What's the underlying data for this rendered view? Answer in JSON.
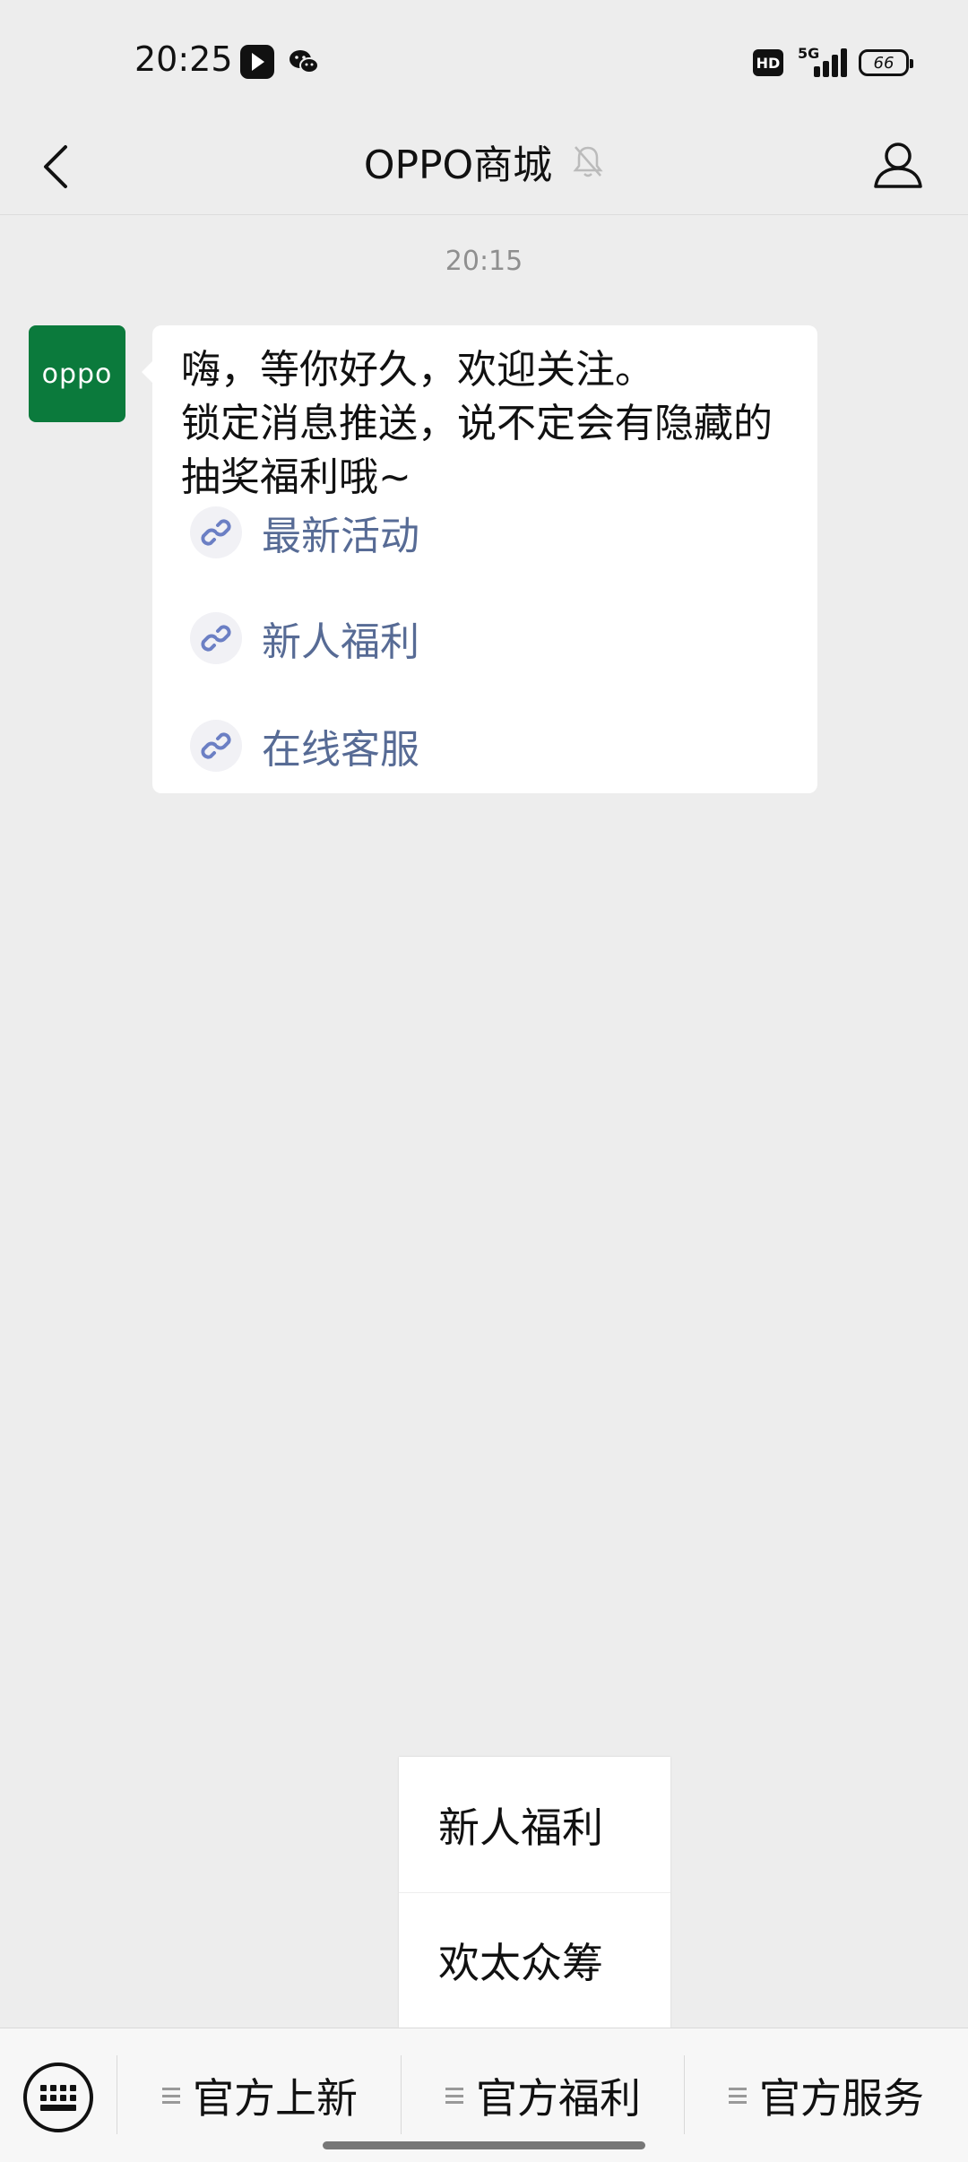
{
  "status_bar": {
    "time": "20:25",
    "hd_badge": "HD",
    "network": "5G",
    "battery": "66"
  },
  "header": {
    "title": "OPPO商城"
  },
  "chat": {
    "timestamp": "20:15",
    "avatar_text": "oppo",
    "message_lines": [
      "嗨，等你好久，欢迎关注。",
      "锁定消息推送，说不定会有隐藏的抽奖福利哦~"
    ],
    "links": [
      {
        "label": "最新活动"
      },
      {
        "label": "新人福利"
      },
      {
        "label": "在线客服"
      }
    ]
  },
  "popup_menu": {
    "items": [
      {
        "label": "新人福利"
      },
      {
        "label": "欢太众筹"
      }
    ]
  },
  "bottom_menu": {
    "items": [
      {
        "label": "官方上新"
      },
      {
        "label": "官方福利"
      },
      {
        "label": "官方服务"
      }
    ]
  },
  "colors": {
    "brand_green": "#0b7a3c",
    "link_blue": "#576b95",
    "page_bg": "#ededed"
  },
  "icons": [
    "back-icon",
    "mute-bell-icon",
    "profile-icon",
    "link-icon",
    "keyboard-icon",
    "menu-lines-icon"
  ]
}
